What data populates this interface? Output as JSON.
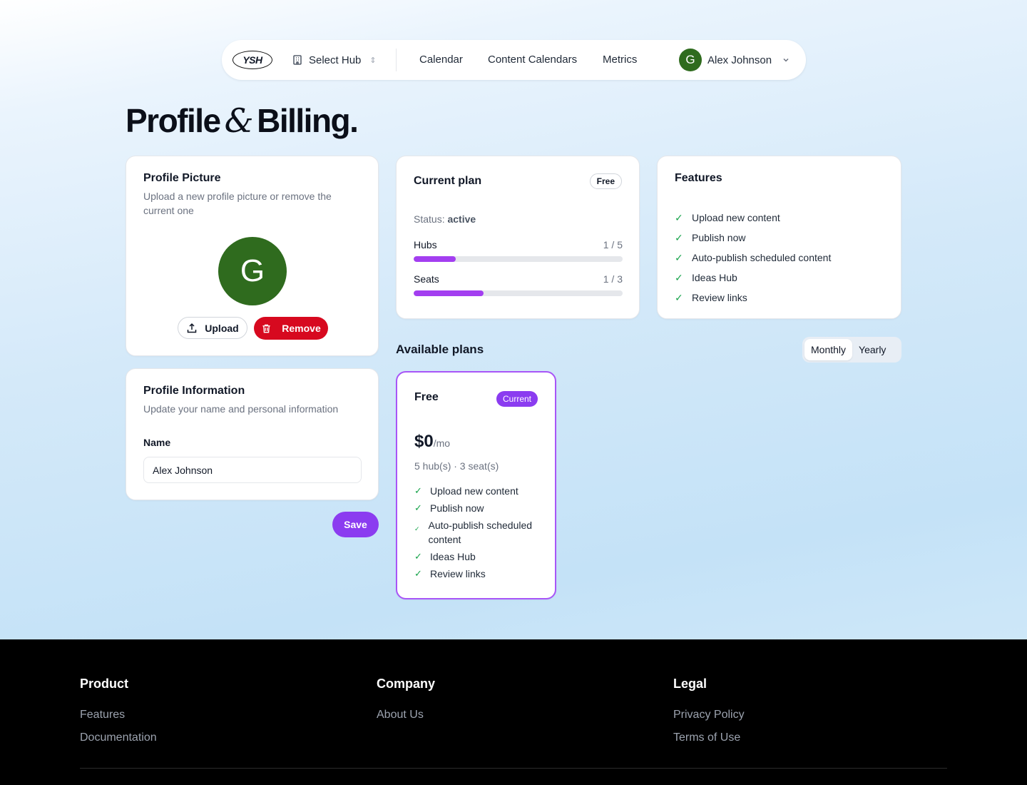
{
  "nav": {
    "logo": "YSH",
    "hub_select": "Select Hub",
    "links": [
      "Calendar",
      "Content Calendars",
      "Metrics"
    ],
    "user_initial": "G",
    "user_name": "Alex Johnson"
  },
  "page": {
    "title_left": "Profile",
    "title_amp": "&",
    "title_right": "Billing."
  },
  "profile_picture": {
    "title": "Profile Picture",
    "subtitle": "Upload a new profile picture or remove the current one",
    "avatar_initial": "G",
    "upload_label": "Upload",
    "remove_label": "Remove"
  },
  "profile_info": {
    "title": "Profile Information",
    "subtitle": "Update your name and personal information",
    "name_label": "Name",
    "name_value": "Alex Johnson",
    "save_label": "Save"
  },
  "current_plan": {
    "title": "Current plan",
    "badge": "Free",
    "status_label": "Status:",
    "status_value": "active",
    "hubs": {
      "label": "Hubs",
      "count": "1 / 5",
      "used": 1,
      "max": 5
    },
    "seats": {
      "label": "Seats",
      "count": "1 / 3",
      "used": 1,
      "max": 3
    }
  },
  "features": {
    "title": "Features",
    "items": [
      "Upload new content",
      "Publish now",
      "Auto-publish scheduled content",
      "Ideas Hub",
      "Review links"
    ]
  },
  "available_plans": {
    "title": "Available plans",
    "toggle": [
      "Monthly",
      "Yearly"
    ],
    "toggle_active": "Monthly",
    "plans": [
      {
        "name": "Free",
        "badge": "Current",
        "price": "$0",
        "per": "/mo",
        "limits": "5 hub(s) · 3 seat(s)",
        "features": [
          "Upload new content",
          "Publish now",
          "Auto-publish scheduled content",
          "Ideas Hub",
          "Review links"
        ]
      }
    ]
  },
  "footer": {
    "columns": [
      {
        "heading": "Product",
        "links": [
          "Features",
          "Documentation"
        ]
      },
      {
        "heading": "Company",
        "links": [
          "About Us"
        ]
      },
      {
        "heading": "Legal",
        "links": [
          "Privacy Policy",
          "Terms of Use"
        ]
      }
    ]
  },
  "colors": {
    "accent": "#8b3cf0",
    "progress": "#a33ef0",
    "danger": "#d7091f",
    "avatar": "#2f6b1e",
    "check": "#16a34a"
  }
}
